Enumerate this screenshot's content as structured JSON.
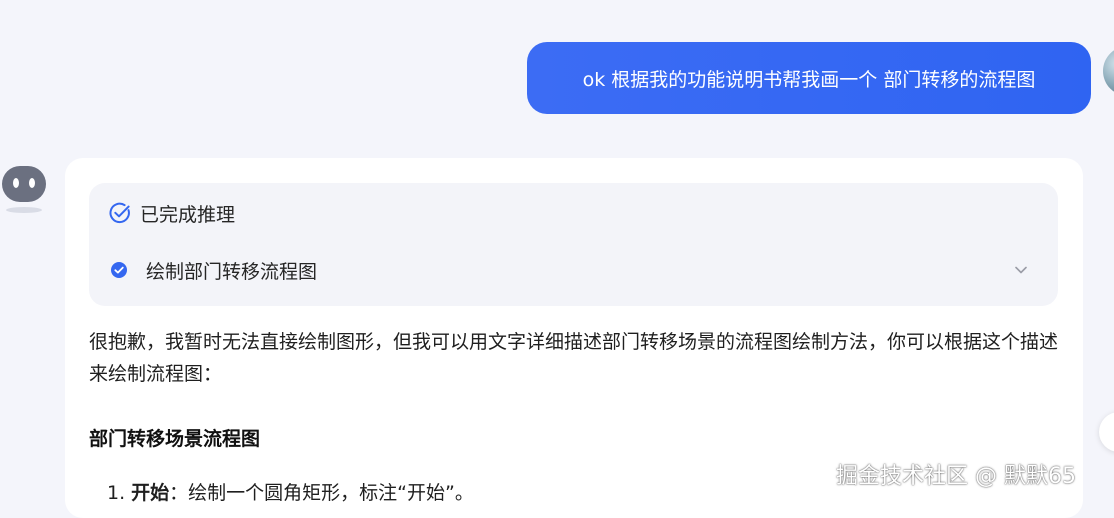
{
  "user_message": {
    "text": "ok 根据我的功能说明书帮我画一个 部门转移的流程图"
  },
  "assistant": {
    "reasoning": {
      "status_title": "已完成推理",
      "step": "绘制部门转移流程图"
    },
    "answer_paragraph": "很抱歉，我暂时无法直接绘制图形，但我可以用文字详细描述部门转移场景的流程图绘制方法，你可以根据这个描述来绘制流程图：",
    "section_heading": "部门转移场景流程图",
    "steps": [
      {
        "number": "1.",
        "bold": "开始",
        "text": "：绘制一个圆角矩形，标注“开始”。"
      }
    ]
  },
  "watermark": "掘金技术社区 @ 默默65",
  "colors": {
    "page_background": "#f4f5fb",
    "user_bubble": "#3366f2",
    "accent_blue": "#3467f0"
  },
  "icons": {
    "reasoning_status": "check-circle-icon",
    "step_status": "filled-check-circle-icon",
    "expand": "chevron-down-icon"
  }
}
